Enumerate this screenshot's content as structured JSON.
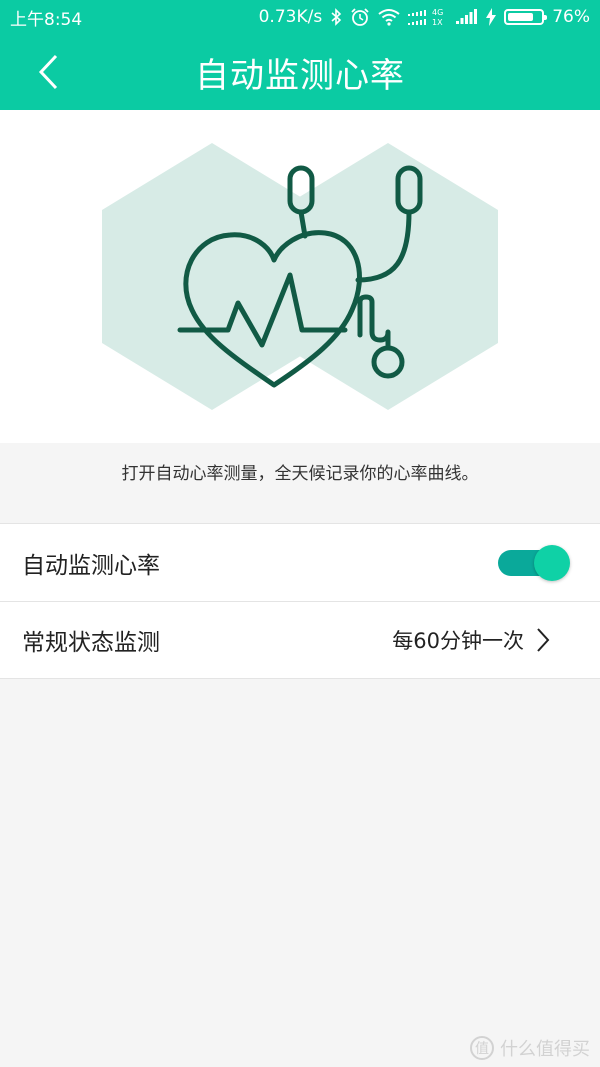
{
  "status_bar": {
    "time": "上午8:54",
    "network_speed": "0.73K/s",
    "battery_percent": "76%",
    "battery_level": 0.76,
    "icons": [
      "bluetooth-icon",
      "alarm-icon",
      "wifi-icon",
      "signal-4g-icon",
      "signal-icon",
      "charging-icon",
      "battery-icon"
    ]
  },
  "appbar": {
    "title": "自动监测心率",
    "back_icon": "chevron-left-icon"
  },
  "hero": {
    "illustration": "heart-stethoscope-icon",
    "colors": {
      "hexagon": "#d7ebe6",
      "line": "#115a45"
    }
  },
  "description": "打开自动心率测量，全天候记录你的心率曲线。",
  "settings": {
    "auto_monitor": {
      "label": "自动监测心率",
      "enabled": true
    },
    "routine_monitor": {
      "label": "常规状态监测",
      "value": "每60分钟一次"
    }
  },
  "watermark": {
    "text": "什么值得买",
    "icon_text": "值"
  },
  "colors": {
    "accent": "#0bcba3",
    "toggle_track": "#0aa99a",
    "toggle_knob": "#0fd1a6",
    "background": "#f5f5f5"
  }
}
